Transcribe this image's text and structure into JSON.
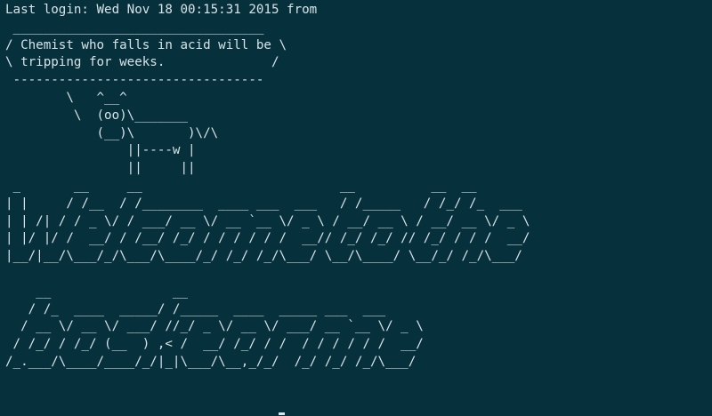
{
  "terminal": {
    "colors": {
      "background": "#06313c",
      "foreground": "#d7e3e7"
    },
    "lines": [
      "Last login: Wed Nov 18 00:15:31 2015 from",
      " _________________________________",
      "/ Chemist who falls in acid will be \\",
      "\\ tripping for weeks.              /",
      " ---------------------------------",
      "        \\   ^__^",
      "         \\  (oo)\\_______",
      "            (__)\\       )\\/\\",
      "                ||----w |",
      "                ||     ||",
      " _       __     __                          __          __  __",
      "| |     / /__  / /________  ____ ___  ___   / /_____   / /_/ /_  ___",
      "| | /| / / _ \\/ / ___/ __ \\/ __ `__ \\/ _ \\ / __/ __ \\ / __/ __ \\/ _ \\",
      "| |/ |/ /  __/ / /__/ /_/ / / / / / /  __// /_/ /_/ // /_/ / / /  __/",
      "|__/|__/\\___/_/\\___/\\____/_/ /_/ /_/\\___/ \\__/\\____/ \\__/_/ /_/\\___/",
      "",
      "    __                __",
      "   / /_  ____  _____/ /_____  ____  _____ ___  ___",
      "  / __ \\/ __ \\/ ___/ //_/ _ \\/ __ \\/ ___/ __ `__ \\/ _ \\",
      " / /_/ / /_/ (__  ) ,< /  __/ /_/ / /  / / / / / /  __/",
      "/_.___/\\____/____/_/|_|\\___/\\__,_/_/  /_/ /_/ /_/\\___/"
    ]
  }
}
